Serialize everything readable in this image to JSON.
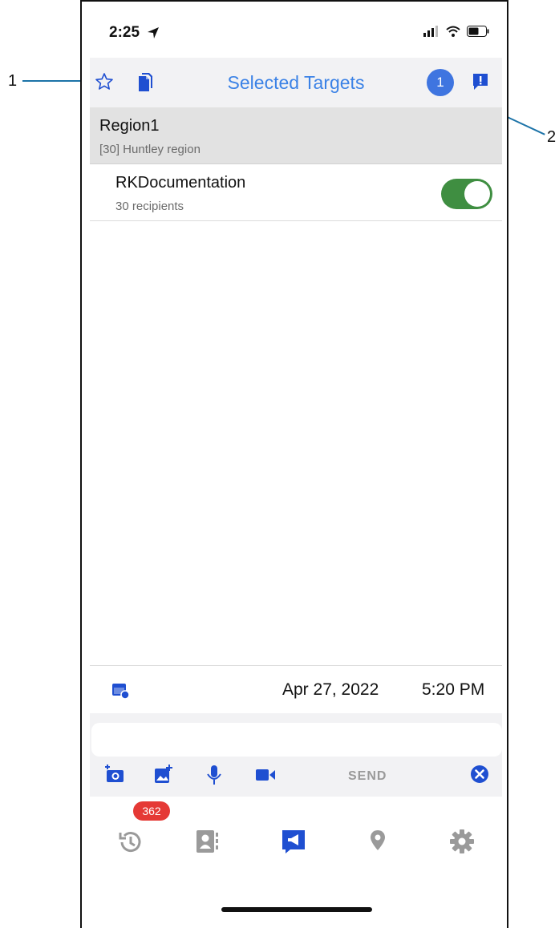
{
  "callouts": {
    "one": "1",
    "two": "2"
  },
  "status_bar": {
    "time": "2:25"
  },
  "header": {
    "title": "Selected Targets",
    "count_badge": "1"
  },
  "group": {
    "title": "Region1",
    "subtitle": "[30] Huntley region"
  },
  "target": {
    "title": "RKDocumentation",
    "subtitle": "30 recipients",
    "enabled": true
  },
  "schedule": {
    "date": "Apr 27, 2022",
    "time": "5:20 PM"
  },
  "compose": {
    "send_label": "SEND",
    "placeholder": ""
  },
  "tabbar": {
    "history_badge": "362"
  },
  "colors": {
    "accent": "#3b82e6",
    "nav_blue": "#1f4fd1",
    "toggle_on": "#3f8e41",
    "badge_red": "#e53935"
  },
  "icons": {
    "header": [
      "star-outline-icon",
      "copy-icon",
      "alert-message-icon"
    ],
    "compose": [
      "add-photo-icon",
      "add-image-icon",
      "microphone-icon",
      "video-icon",
      "clear-icon"
    ],
    "tabs": [
      "history-icon",
      "contacts-icon",
      "broadcast-icon",
      "location-pin-icon",
      "settings-icon"
    ]
  }
}
